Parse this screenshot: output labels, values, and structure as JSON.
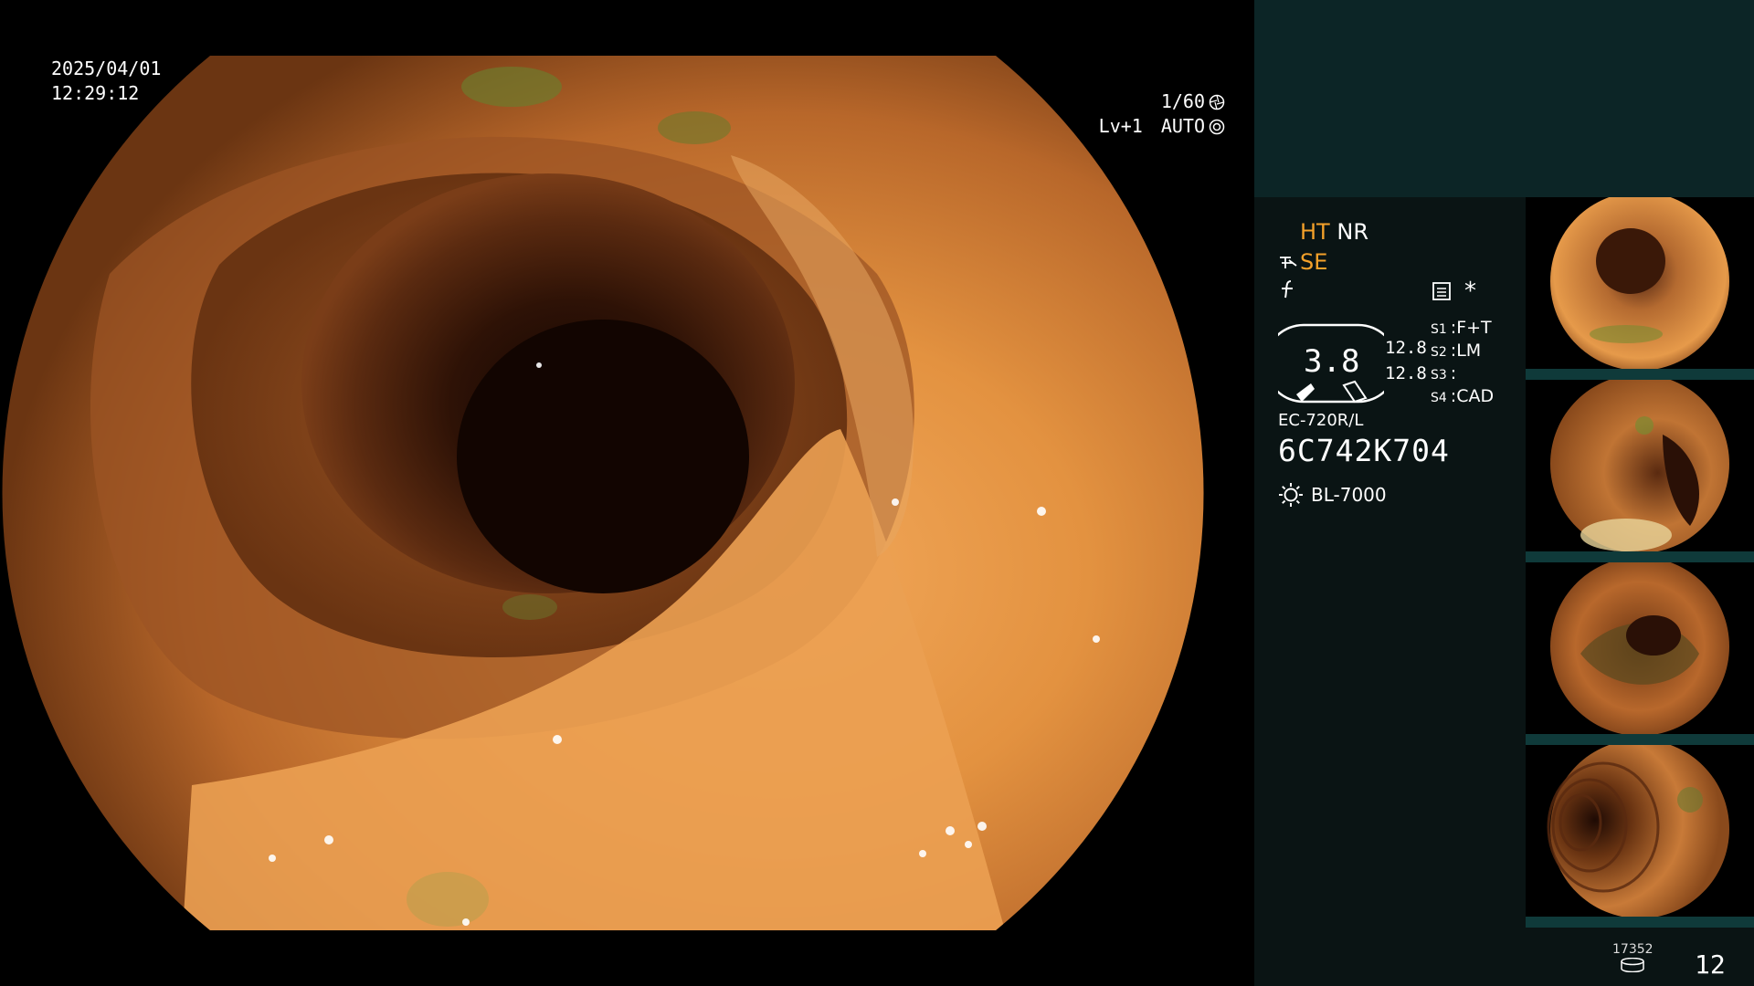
{
  "overlay": {
    "date": "2025/04/01",
    "time": "12:29:12",
    "shutter_speed": "1/60",
    "level": "Lv+1",
    "mode": "AUTO"
  },
  "panel": {
    "ht_label": "HT",
    "nr_label": "NR",
    "se_label": "SE",
    "asterisk": "*",
    "gauge_value": "3.8",
    "gauge_v1": "12.8",
    "gauge_v2": "12.8",
    "s_labels": [
      "S1",
      "S2",
      "S3",
      "S4"
    ],
    "s_values": [
      "F+T",
      "LM",
      "",
      "CAD"
    ],
    "scope_model": "EC-720R/L",
    "scope_serial": "6C742K704",
    "light_source": "BL-7000"
  },
  "footer": {
    "small_counter": "17352",
    "image_count": "12"
  },
  "colors": {
    "panel_bg": "#0a1414",
    "panel_top": "#0c2526",
    "accent_orange": "#f4a12a",
    "tissue_base": "#d98632"
  },
  "icons": [
    "shutter-icon",
    "auto-iris-icon",
    "enhance-icon",
    "f-icon",
    "menu-list-icon",
    "light-bulb-icon",
    "disk-icon"
  ]
}
